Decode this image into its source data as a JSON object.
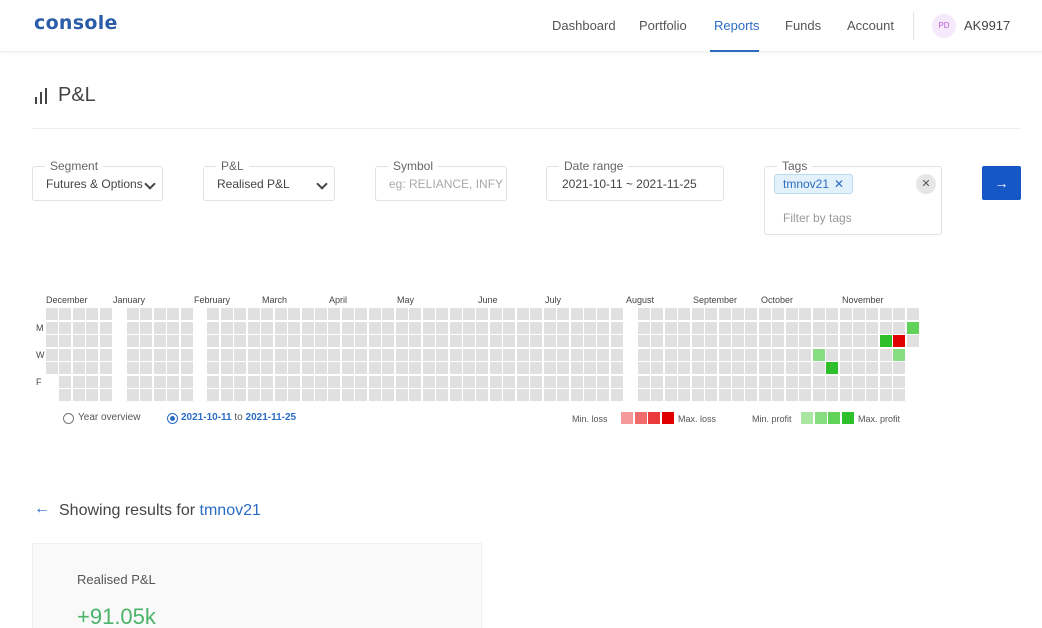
{
  "app": {
    "logo": "console"
  },
  "nav": {
    "items": [
      {
        "label": "Dashboard",
        "active": false
      },
      {
        "label": "Portfolio",
        "active": false
      },
      {
        "label": "Reports",
        "active": true
      },
      {
        "label": "Funds",
        "active": false
      },
      {
        "label": "Account",
        "active": false
      }
    ],
    "user": {
      "initials": "PD",
      "id": "AK9917"
    }
  },
  "page": {
    "title": "P&L",
    "icon": "bar-chart-icon"
  },
  "filters": {
    "segment": {
      "label": "Segment",
      "value": "Futures & Options"
    },
    "pnl": {
      "label": "P&L",
      "value": "Realised P&L"
    },
    "symbol": {
      "label": "Symbol",
      "placeholder": "eg: RELIANCE, INFY"
    },
    "date_range": {
      "label": "Date range",
      "value": "2021-10-11 ~ 2021-11-25"
    },
    "tags": {
      "label": "Tags",
      "selected": "tmnov21",
      "filter_placeholder": "Filter by tags",
      "clear_icon": "close-icon"
    },
    "submit_icon": "arrow-right-icon"
  },
  "heatmap": {
    "months": [
      "December",
      "January",
      "February",
      "March",
      "April",
      "May",
      "June",
      "July",
      "August",
      "September",
      "October",
      "November"
    ],
    "day_labels": [
      "M",
      "W",
      "F"
    ],
    "options": {
      "year_label": "Year overview",
      "range_from": "2021-10-11",
      "range_mid": "to",
      "range_to": "2021-11-25",
      "selected": "range"
    },
    "legend": {
      "min_loss": "Min. loss",
      "max_loss": "Max. loss",
      "min_profit": "Min. profit",
      "max_profit": "Max. profit",
      "loss_colors": [
        "#f59a9a",
        "#f06c6c",
        "#eb3a3a",
        "#e00000"
      ],
      "profit_colors": [
        "#a8e6a1",
        "#88dd80",
        "#5fd257",
        "#2fbf2a"
      ]
    }
  },
  "results": {
    "prefix": "Showing results for",
    "tag": "tmnov21",
    "back_icon": "arrow-left-icon",
    "realised_label": "Realised P&L",
    "realised_value": "+91.05k"
  },
  "colors": {
    "accent": "#2b6cc4",
    "button": "#1457c5",
    "profit": "#4bb469",
    "empty_cell": "#e0e0e0"
  }
}
